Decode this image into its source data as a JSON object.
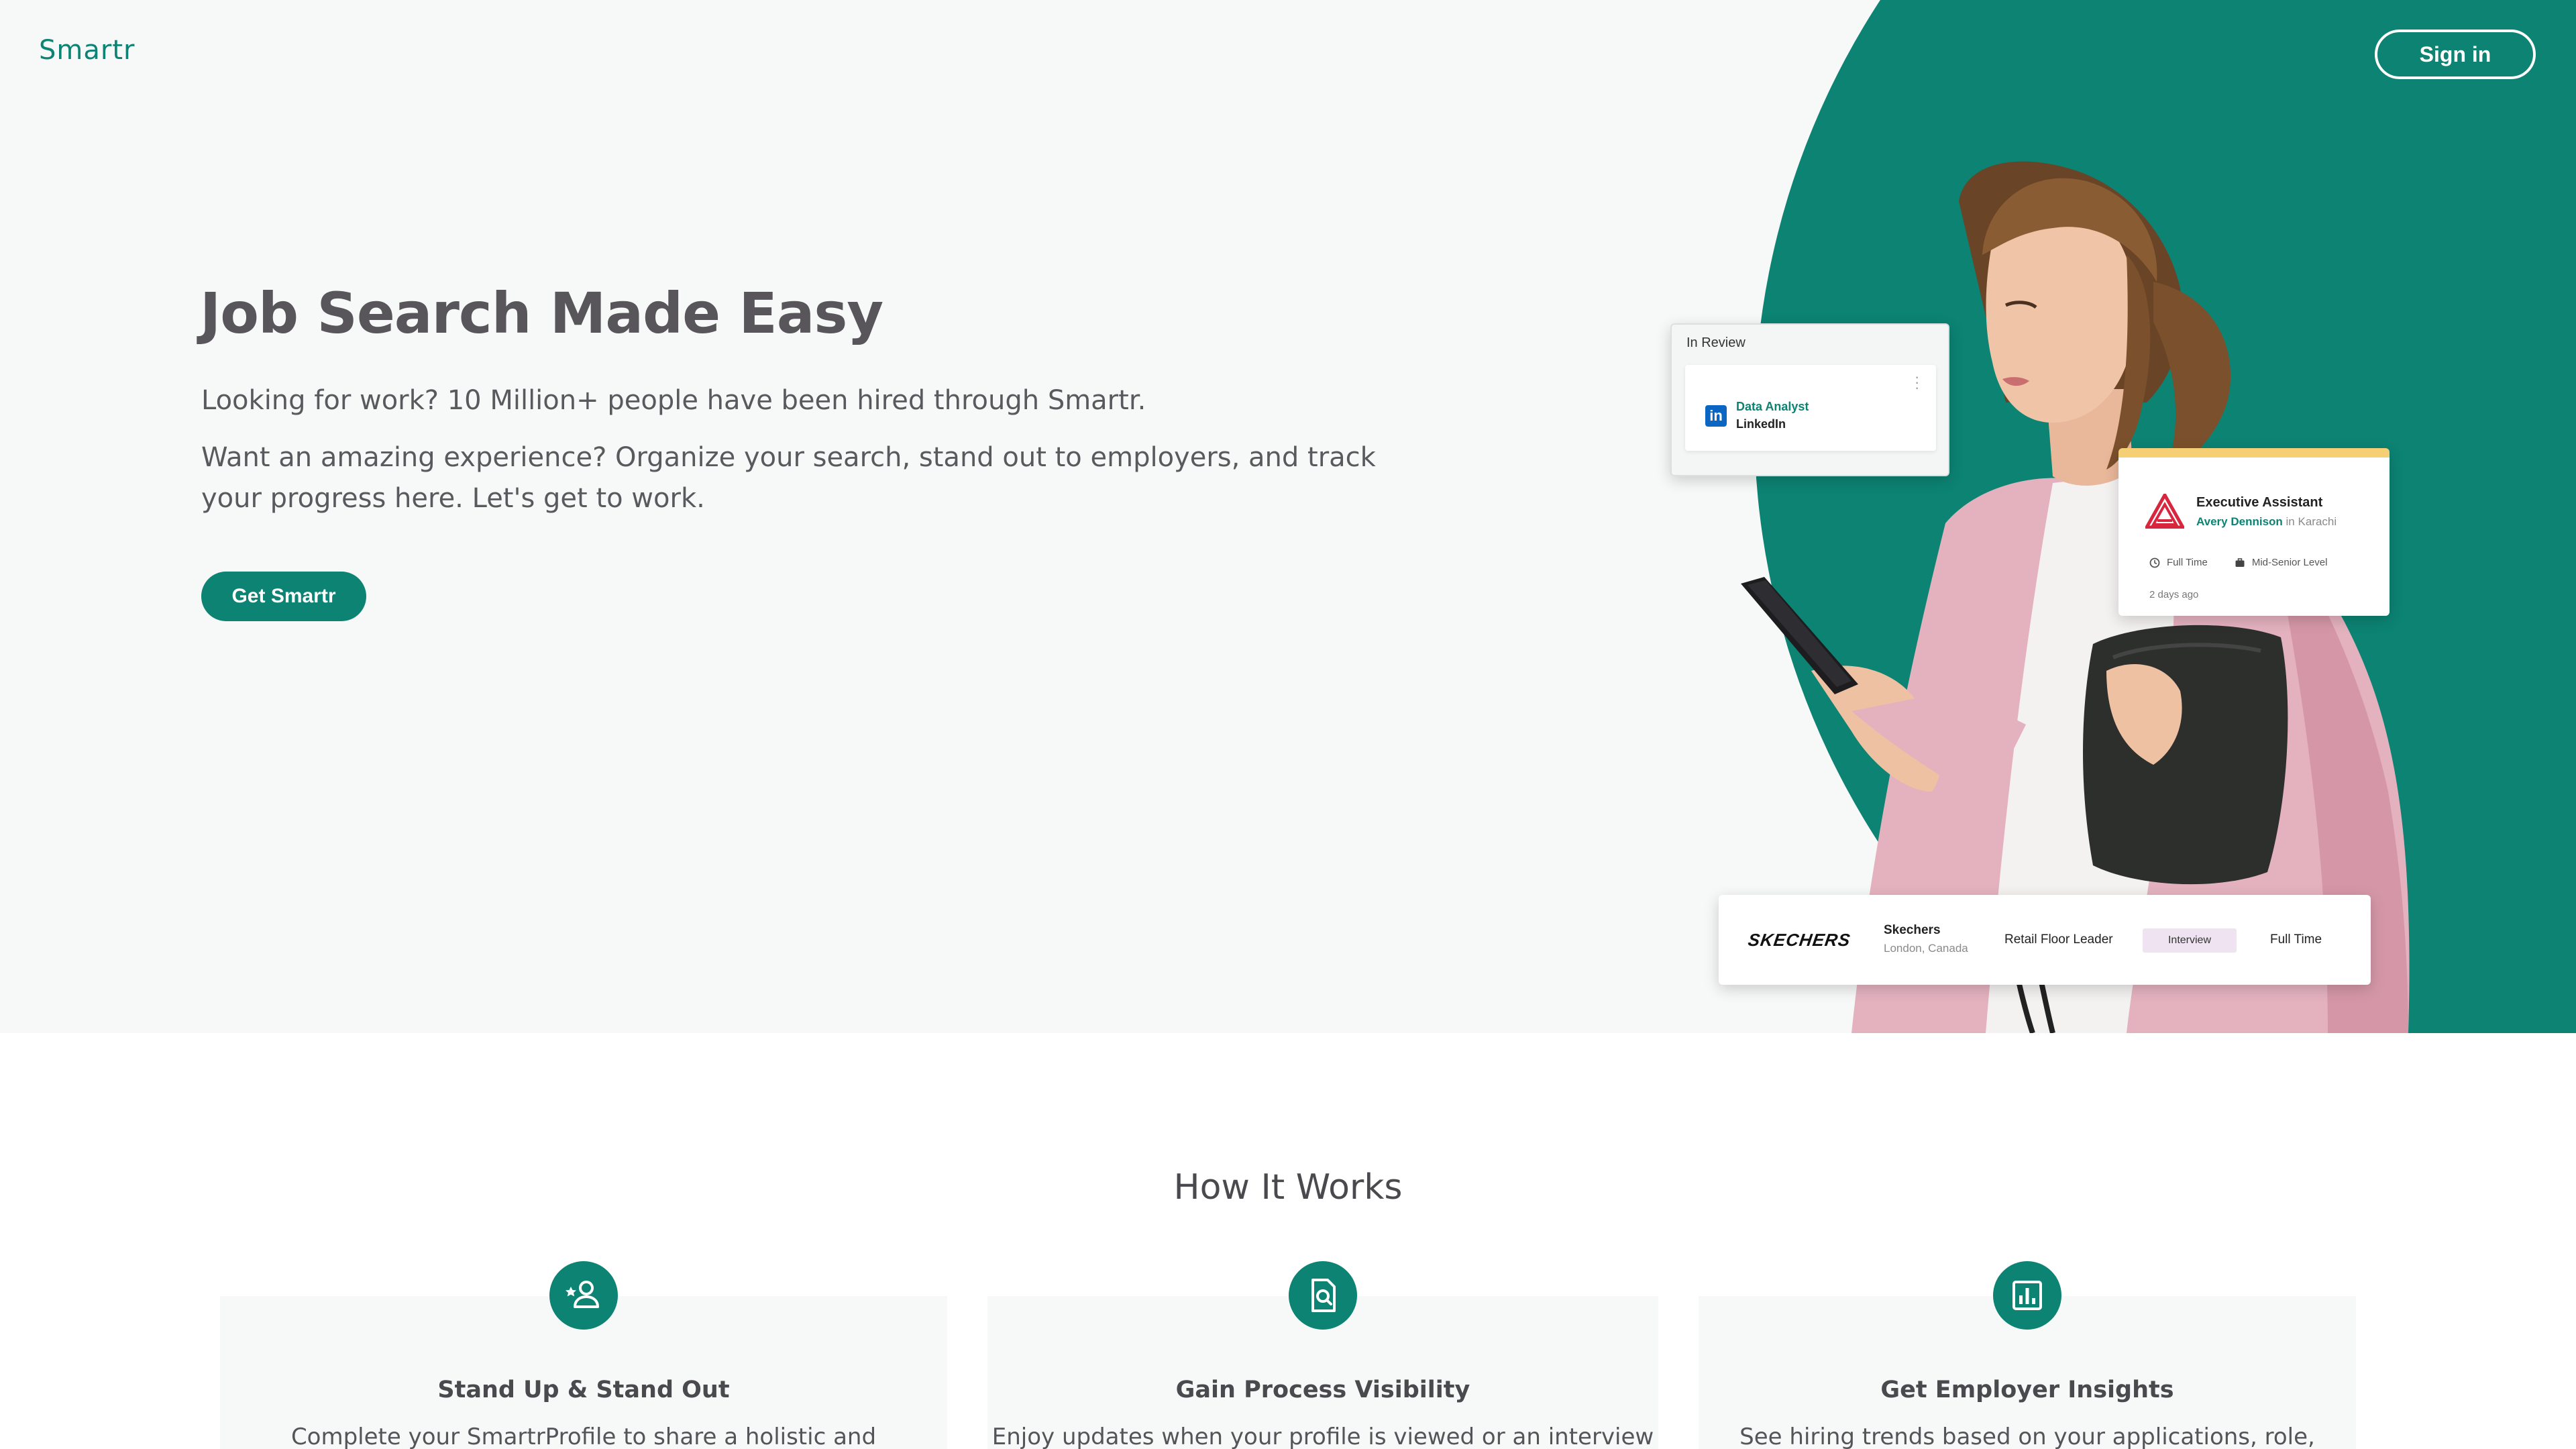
{
  "header": {
    "logo": "Smartr",
    "signin_label": "Sign in"
  },
  "hero": {
    "title": "Job Search Made Easy",
    "subtitle": "Looking for work? 10 Million+ people have been hired through Smartr.",
    "body": "Want an amazing experience? Organize your search, stand out to employers, and track your progress here. Let's get to work.",
    "cta_label": "Get Smartr"
  },
  "cards": {
    "review": {
      "status": "In Review",
      "role": "Data Analyst",
      "company": "LinkedIn"
    },
    "exec": {
      "title": "Executive Assistant",
      "employer": "Avery Dennison",
      "location_prefix": "in",
      "location": "Karachi",
      "employment_type": "Full Time",
      "level": "Mid-Senior Level",
      "posted": "2 days ago"
    },
    "skechers": {
      "brand": "SKECHERS",
      "name": "Skechers",
      "location": "London, Canada",
      "role": "Retail Floor Leader",
      "stage": "Interview",
      "employment_type": "Full Time"
    }
  },
  "how_it_works": {
    "title": "How It Works",
    "features": [
      {
        "icon": "person-star-icon",
        "title": "Stand Up & Stand Out",
        "desc": "Complete your SmartrProfile to share a holistic and"
      },
      {
        "icon": "document-search-icon",
        "title": "Gain Process Visibility",
        "desc": "Enjoy updates when your profile is viewed or an interview"
      },
      {
        "icon": "bar-chart-icon",
        "title": "Get Employer Insights",
        "desc": "See hiring trends based on your applications, role,"
      }
    ]
  },
  "colors": {
    "brand": "#0c8373",
    "hero_bg": "#f7f8f8",
    "text": "#555559",
    "exec_accent": "#f5cf73",
    "interview_badge": "#efe3f1"
  }
}
